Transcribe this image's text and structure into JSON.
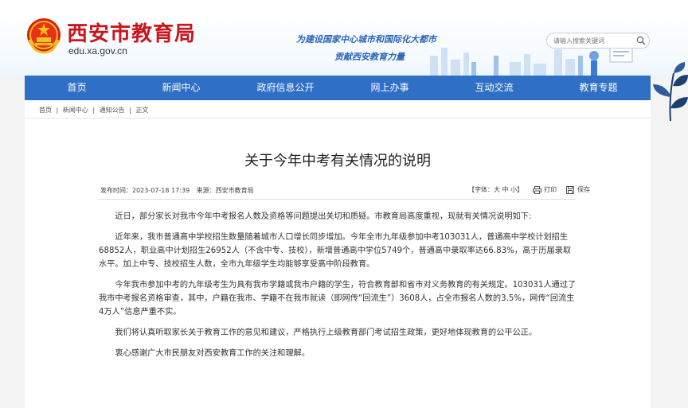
{
  "site": {
    "name": "西安市教育局",
    "domain": "edu.xa.gov.cn",
    "slogan_line1": "为建设国家中心城市和国际化大都市",
    "slogan_line2": "贡献西安教育力量",
    "search_placeholder": "请输入搜索关键词"
  },
  "nav": {
    "items": [
      "首页",
      "新闻中心",
      "政府信息公开",
      "网上办事",
      "互动交流",
      "教育专题"
    ]
  },
  "breadcrumb": [
    "首页",
    "|",
    "新闻中心",
    "|",
    "通知公告",
    "|",
    "正文"
  ],
  "article": {
    "title": "关于今年中考有关情况的说明",
    "publish_time": "发布时间：2023-07-18 17:39",
    "source": "来源：西安市教育局",
    "font_size_label": "【字体：大 中 小】",
    "print_label": "打印",
    "save_label": "保存",
    "paragraphs": [
      "近日，部分家长对我市今年中考报名人数及资格等问题提出关切和质疑。市教育局高度重视，现就有关情况说明如下:",
      "近年来，我市普通高中学校招生数量随着城市人口增长同步增加。今年全市九年级参加中考103031人，普通高中学校计划招生68852人，职业高中计划招生26952人（不含中专、技校），新增普通高中学位5749个，普通高中录取率达66.83%，高于历届录取水平。加上中专、技校招生人数，全市九年级学生均能够享受高中阶段教育。",
      "今年我市参加中考的九年级考生为具有我市学籍或我市户籍的学生，符合教育部和省市对义务教育的有关规定。103031人通过了我市中考报名资格审查，其中，户籍在我市、学籍不在我市就读（即网传“回流生”）3608人，占全市报名人数的3.5%，网传“回流生4万人”信息严重不实。",
      "我们将认真听取家长关于教育工作的意见和建议，严格执行上级教育部门考试招生政策，更好地体现教育的公平公正。",
      "衷心感谢广大市民朋友对西安教育工作的关注和理解。"
    ]
  },
  "colors": {
    "brand_red": "#c8161d",
    "nav_blue": "#2f6fc6",
    "slogan_blue": "#2a64b8"
  }
}
